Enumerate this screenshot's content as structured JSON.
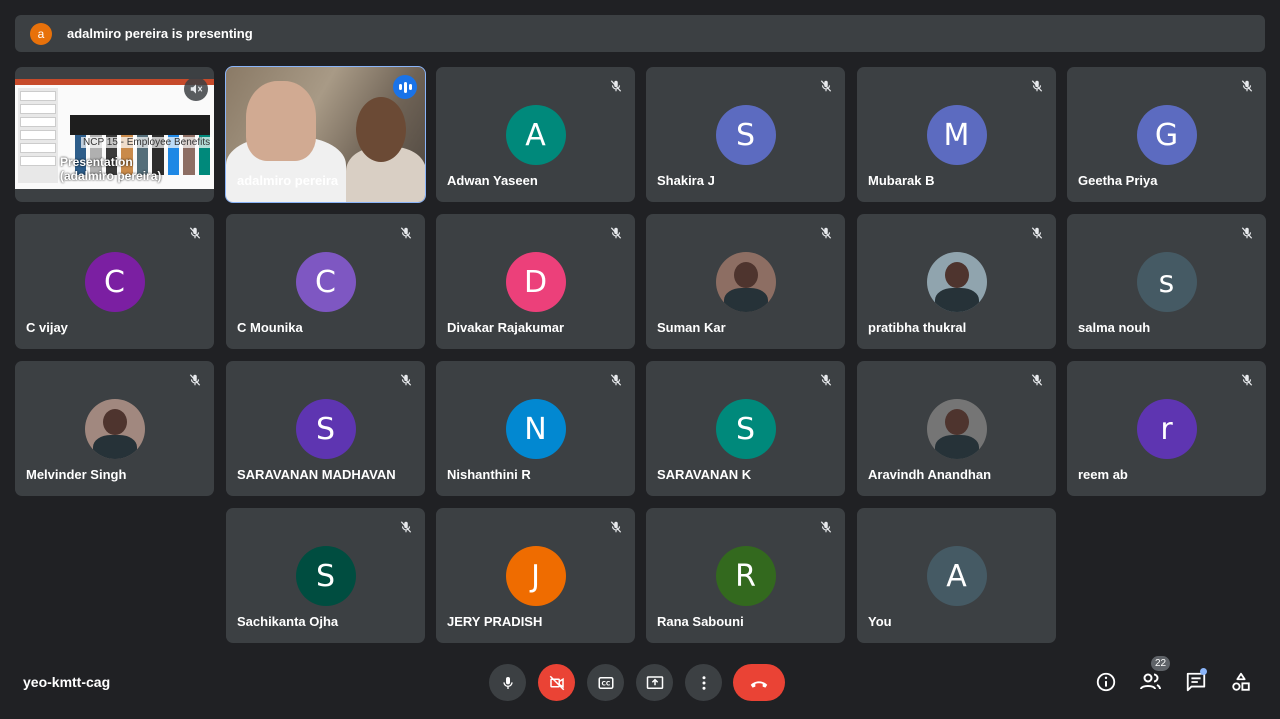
{
  "banner": {
    "avatar_letter": "a",
    "text": "adalmiro pereira is presenting"
  },
  "presentation_tile": {
    "label_line1": "Presentation",
    "label_line2": "(adalmiro pereira)",
    "slide_title": "NCP 15 - Employee Benefits"
  },
  "speaker_tile": {
    "name": "adalmiro pereira"
  },
  "participants": [
    {
      "name": "Adwan Yaseen",
      "letter": "A",
      "color": "#00897b"
    },
    {
      "name": "Shakira J",
      "letter": "S",
      "color": "#5c6bc0"
    },
    {
      "name": "Mubarak B",
      "letter": "M",
      "color": "#5c6bc0"
    },
    {
      "name": "Geetha Priya",
      "letter": "G",
      "color": "#5c6bc0"
    },
    {
      "name": "C vijay",
      "letter": "C",
      "color": "#7b1fa2"
    },
    {
      "name": "C Mounika",
      "letter": "C",
      "color": "#7e57c2"
    },
    {
      "name": "Divakar Rajakumar",
      "letter": "D",
      "color": "#ec407a"
    },
    {
      "name": "Suman Kar",
      "letter": "",
      "color": "#8d6e63",
      "photo": true
    },
    {
      "name": "pratibha thukral",
      "letter": "",
      "color": "#90a4ae",
      "photo": true
    },
    {
      "name": "salma nouh",
      "letter": "s",
      "color": "#455a64"
    },
    {
      "name": "Melvinder Singh",
      "letter": "",
      "color": "#a1887f",
      "photo": true
    },
    {
      "name": "SARAVANAN MADHAVAN",
      "letter": "S",
      "color": "#5e35b1"
    },
    {
      "name": "Nishanthini R",
      "letter": "N",
      "color": "#0288d1"
    },
    {
      "name": "SARAVANAN K",
      "letter": "S",
      "color": "#00897b"
    },
    {
      "name": "Aravindh Anandhan",
      "letter": "",
      "color": "#757575",
      "photo": true
    },
    {
      "name": "reem ab",
      "letter": "r",
      "color": "#5e35b1"
    },
    {
      "name": "Sachikanta Ojha",
      "letter": "S",
      "color": "#004d40"
    },
    {
      "name": "JERY PRADISH",
      "letter": "J",
      "color": "#ef6c00"
    },
    {
      "name": "Rana Sabouni",
      "letter": "R",
      "color": "#33691e"
    },
    {
      "name": "You",
      "letter": "A",
      "color": "#455a64"
    }
  ],
  "bottom_bar": {
    "meeting_code": "yeo-kmtt-cag",
    "people_count": "22"
  },
  "icons": {
    "mic": "mic-icon",
    "camera_off": "camera-off-icon",
    "captions": "captions-icon",
    "present": "present-screen-icon",
    "more": "more-options-icon",
    "hangup": "hangup-icon",
    "info": "info-icon",
    "people": "people-icon",
    "chat": "chat-icon",
    "activities": "activities-icon"
  }
}
